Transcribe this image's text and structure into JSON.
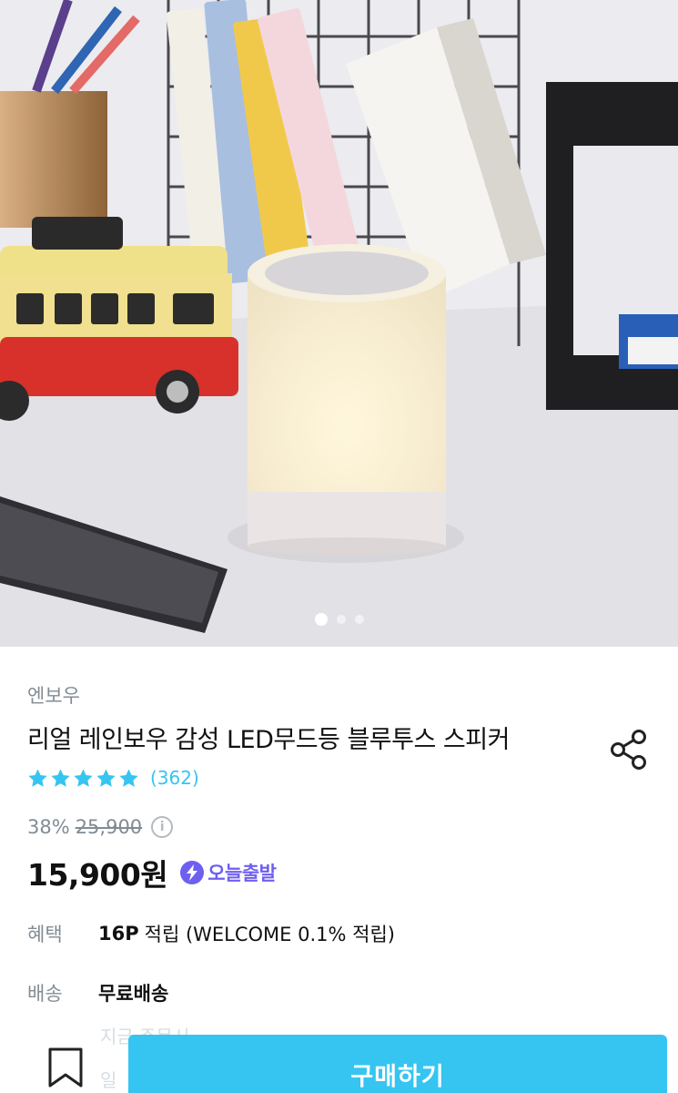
{
  "product": {
    "brand": "엔보우",
    "title": "리얼 레인보우 감성 LED무드등 블루투스 스피커",
    "rating_stars": 5,
    "review_count": "(362)",
    "discount": "38%",
    "original_price": "25,900",
    "price": "15,900원",
    "today_badge": "오늘출발"
  },
  "benefit": {
    "label": "혜택",
    "points": "16P",
    "text": "적립 (WELCOME 0.1% 적립)"
  },
  "shipping": {
    "label": "배송",
    "value": "무료배송"
  },
  "faded_lines": [
    "지금 주문시 ··· ··· ·",
    "일"
  ],
  "carousel": {
    "count": 3,
    "active": 1
  },
  "actions": {
    "buy_label": "구매하기"
  },
  "icons": {
    "share": "share-icon",
    "info": "info-icon",
    "bookmark": "bookmark-icon",
    "star": "star-icon",
    "bolt": "lightning-icon"
  },
  "colors": {
    "accent": "#35c5f0",
    "badge": "#6e5ff0",
    "muted": "#828c94"
  }
}
